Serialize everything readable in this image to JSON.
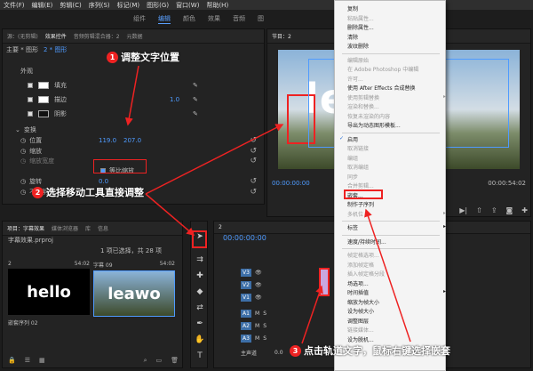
{
  "menubar": [
    "文件(F)",
    "编辑(E)",
    "剪辑(C)",
    "序列(S)",
    "标记(M)",
    "图形(G)",
    "窗口(W)",
    "帮助(H)"
  ],
  "workspaces": [
    "组件",
    "编辑",
    "颜色",
    "效果",
    "音频",
    "图"
  ],
  "top_left_tabs": [
    "源：(无剪辑)",
    "效果控件",
    "音频剪辑混合器：2",
    "元数据"
  ],
  "effect_controls": {
    "clip_label": "主要 * 图形",
    "clip_target": "2 * 图形",
    "appearance_label": "外观",
    "fill_label": "填充",
    "stroke_label": "描边",
    "stroke_value": "1.0",
    "shadow_label": "阴影",
    "transform_label": "变换",
    "position_label": "位置",
    "position_x": "119.0",
    "position_y": "207.0",
    "scale_label": "缩放",
    "scale_width_label": "缩放宽度",
    "uniform_scale_label": "等比缩放",
    "rotation_label": "旋转",
    "rotation_value": "0.0",
    "opacity_label": "不透明度"
  },
  "program_monitor": {
    "title": "节目：2",
    "title_text": "leawo",
    "timecode": "00:00:00:00",
    "duration": "00:00:54:02"
  },
  "project_panel": {
    "tabs": [
      "项目：字幕效果",
      "媒体浏览器",
      "库",
      "信息"
    ],
    "file": "字幕效果.prproj",
    "count": "1 项已选择，共 28 项",
    "clips": [
      {
        "label": "2",
        "duration": "54:02",
        "text": "hello",
        "name": "嵌套序列 02"
      },
      {
        "label": "字幕 09",
        "duration": "54:02",
        "text": "leawo",
        "name": "字幕 09"
      }
    ]
  },
  "timeline": {
    "title": "2",
    "timecode": "00:00:00:00",
    "tracks": [
      "V3",
      "V2",
      "V1",
      "A1",
      "A2",
      "A3"
    ],
    "master": "主声道",
    "master_value": "0.0"
  },
  "context_menu": {
    "items": [
      {
        "label": "复制",
        "disabled": false
      },
      {
        "label": "粘贴属性...",
        "disabled": true
      },
      {
        "label": "删除属性...",
        "disabled": false
      },
      {
        "label": "清除",
        "disabled": false
      },
      {
        "label": "波纹删除",
        "disabled": false
      },
      {
        "sep": true
      },
      {
        "label": "编辑原始",
        "disabled": true
      },
      {
        "label": "在 Adobe Photoshop 中编辑",
        "disabled": true
      },
      {
        "label": "许可...",
        "disabled": true
      },
      {
        "label": "使用 After Effects 合成替换",
        "disabled": false
      },
      {
        "label": "使用剪辑替换",
        "disabled": true,
        "arrow": true
      },
      {
        "label": "渲染和替换...",
        "disabled": true
      },
      {
        "label": "恢复未渲染的内容",
        "disabled": true
      },
      {
        "label": "导出为动态图形模板...",
        "disabled": false
      },
      {
        "sep": true
      },
      {
        "label": "启用",
        "disabled": false,
        "check": true
      },
      {
        "label": "取消链接",
        "disabled": true
      },
      {
        "label": "编组",
        "disabled": true
      },
      {
        "label": "取消编组",
        "disabled": true
      },
      {
        "label": "同步",
        "disabled": true
      },
      {
        "label": "合并剪辑...",
        "disabled": true
      },
      {
        "label": "嵌套...",
        "disabled": false,
        "highlight": true
      },
      {
        "label": "制作子序列",
        "disabled": false
      },
      {
        "label": "多机位",
        "disabled": true,
        "arrow": true
      },
      {
        "sep": true
      },
      {
        "label": "标签",
        "disabled": false,
        "arrow": true
      },
      {
        "sep": true
      },
      {
        "label": "速度/持续时间...",
        "disabled": false
      },
      {
        "sep": true
      },
      {
        "label": "帧定格选项...",
        "disabled": true
      },
      {
        "label": "添加帧定格",
        "disabled": true
      },
      {
        "label": "插入帧定格分段",
        "disabled": true
      },
      {
        "label": "场选项...",
        "disabled": false
      },
      {
        "label": "时间插值",
        "disabled": false,
        "arrow": true
      },
      {
        "label": "缩放为帧大小",
        "disabled": false
      },
      {
        "label": "设为帧大小",
        "disabled": false
      },
      {
        "label": "调整图层",
        "disabled": false
      },
      {
        "label": "链接媒体...",
        "disabled": true
      },
      {
        "label": "设为脱机...",
        "disabled": false
      }
    ]
  },
  "callouts": {
    "c1": {
      "num": "1",
      "text": "调整文字位置"
    },
    "c2": {
      "num": "2",
      "text": "选择移动工具直接调整"
    },
    "c3": {
      "num": "3",
      "text": "点击轨道文字，鼠标右键选择嵌套"
    }
  },
  "colors": {
    "accent": "#4f9bff",
    "callout": "#e22222",
    "highlight_box": "#e22222"
  }
}
